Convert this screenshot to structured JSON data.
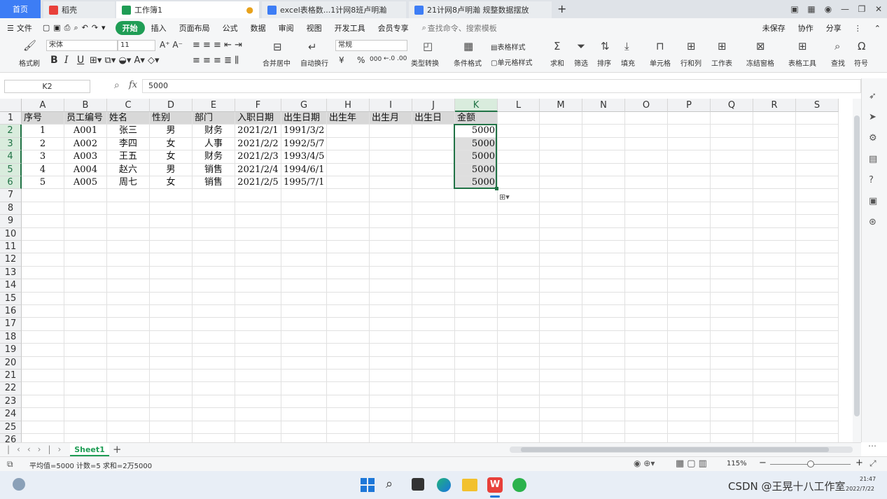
{
  "tabs": {
    "home": "首页",
    "t1": "稻壳",
    "t2": "工作簿1",
    "t3": "excel表格数...1计网8班卢明瀚",
    "t4": "21计网8卢明瀚 规整数据摆放",
    "add": "+"
  },
  "menu": {
    "file": "文件",
    "items": [
      "开始",
      "插入",
      "页面布局",
      "公式",
      "数据",
      "审阅",
      "视图",
      "开发工具",
      "会员专享"
    ],
    "search": "查找命令、搜索模板",
    "unsaved": "未保存",
    "collab": "协作",
    "share": "分享"
  },
  "ribbon": {
    "format_painter": "格式刷",
    "font": "宋体",
    "size": "11",
    "bold": "B",
    "italic": "I",
    "underline": "U",
    "merge": "合并居中",
    "wrap": "自动换行",
    "numfmt": "常规",
    "typeconv": "类型转换",
    "condfmt": "条件格式",
    "tablestyle": "表格样式",
    "cellstyle": "单元格样式",
    "sum": "求和",
    "filter": "筛选",
    "sort": "排序",
    "fill": "填充",
    "cell": "单元格",
    "rowcol": "行和列",
    "sheet": "工作表",
    "freeze": "冻结窗格",
    "tabletool": "表格工具",
    "find": "查找",
    "symbol": "符号",
    "percent": "%",
    "currency": "¥",
    "thousands": "000"
  },
  "formula": {
    "namebox": "K2",
    "fx": "fx",
    "value": "5000"
  },
  "columns": [
    "A",
    "B",
    "C",
    "D",
    "E",
    "F",
    "G",
    "H",
    "I",
    "J",
    "K",
    "L",
    "M",
    "N",
    "O",
    "P",
    "Q",
    "R",
    "S"
  ],
  "rows": [
    "1",
    "2",
    "3",
    "4",
    "5",
    "6",
    "7",
    "8",
    "9",
    "10",
    "11",
    "12",
    "13",
    "14",
    "15",
    "16",
    "17",
    "18",
    "19",
    "20",
    "21",
    "22",
    "23",
    "24",
    "25",
    "26"
  ],
  "header": [
    "序号",
    "员工编号",
    "姓名",
    "性别",
    "部门",
    "入职日期",
    "出生日期",
    "出生年",
    "出生月",
    "出生日",
    "金额"
  ],
  "data": [
    [
      "1",
      "A001",
      "张三",
      "男",
      "财务",
      "2021/2/1",
      "1991/3/2",
      "",
      "",
      "",
      "5000"
    ],
    [
      "2",
      "A002",
      "李四",
      "女",
      "人事",
      "2021/2/2",
      "1992/5/7",
      "",
      "",
      "",
      "5000"
    ],
    [
      "3",
      "A003",
      "王五",
      "女",
      "财务",
      "2021/2/3",
      "1993/4/5",
      "",
      "",
      "",
      "5000"
    ],
    [
      "4",
      "A004",
      "赵六",
      "男",
      "销售",
      "2021/2/4",
      "1994/6/1",
      "",
      "",
      "",
      "5000"
    ],
    [
      "5",
      "A005",
      "周七",
      "女",
      "销售",
      "2021/2/5",
      "1995/7/1",
      "",
      "",
      "",
      "5000"
    ]
  ],
  "sheet": {
    "name": "Sheet1",
    "add": "+"
  },
  "status": {
    "summary": "平均值=5000  计数=5  求和=2万5000",
    "zoom": "115%"
  },
  "taskbar": {
    "watermark": "CSDN @王晃十八工作室",
    "time": "21:47",
    "date": "2022/7/22"
  }
}
